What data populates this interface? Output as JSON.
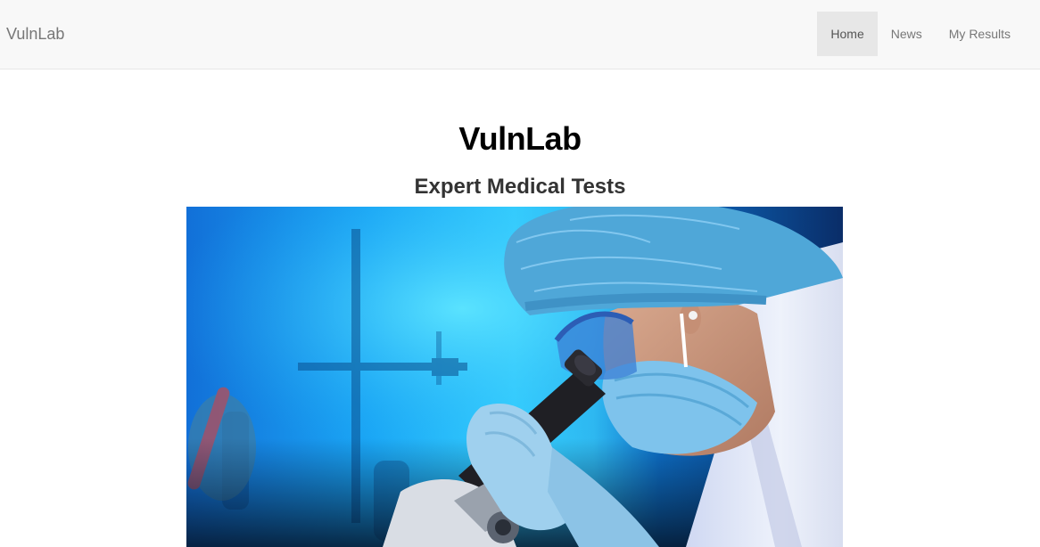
{
  "navbar": {
    "brand": "VulnLab",
    "items": [
      {
        "label": "Home",
        "active": true
      },
      {
        "label": "News",
        "active": false
      },
      {
        "label": "My Results",
        "active": false
      }
    ]
  },
  "hero": {
    "title": "VulnLab",
    "subtitle": "Expert Medical Tests",
    "image": {
      "subject": "lab scientist with hair net, mask and gloves looking into a microscope",
      "colors": {
        "background_blue": "#1aa6f5",
        "cap_blue": "#4fa7d8",
        "coat_white": "#e9eef8",
        "microscope_black": "#1f1f24"
      }
    }
  }
}
